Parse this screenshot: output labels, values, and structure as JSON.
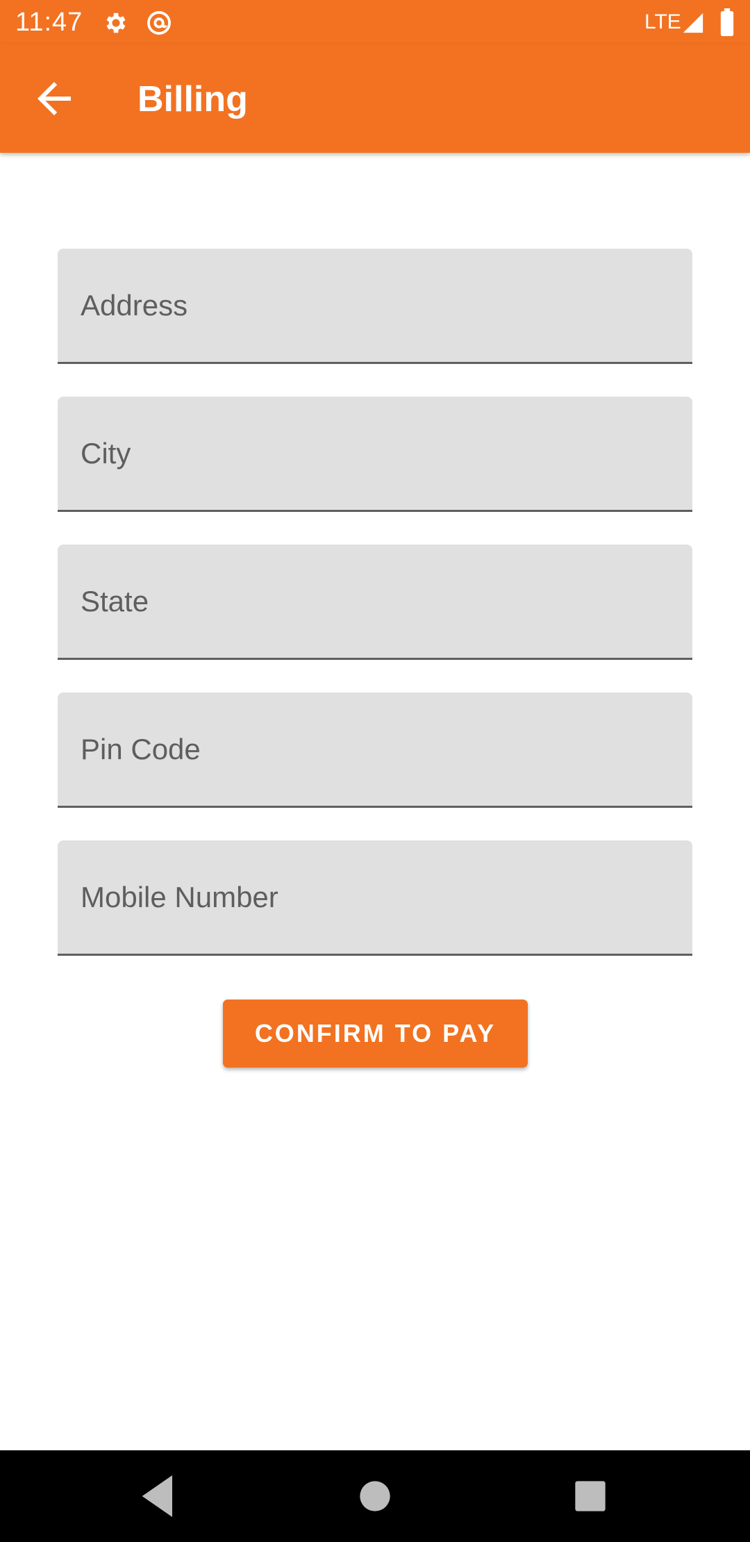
{
  "status_bar": {
    "time": "11:47",
    "network": "LTE",
    "icons": [
      "gear-icon",
      "at-sign-icon",
      "signal-icon",
      "battery-icon"
    ]
  },
  "app_bar": {
    "title": "Billing",
    "back_icon": "arrow-back-icon"
  },
  "form": {
    "fields": [
      {
        "name": "address",
        "placeholder": "Address",
        "value": ""
      },
      {
        "name": "city",
        "placeholder": "City",
        "value": ""
      },
      {
        "name": "state",
        "placeholder": "State",
        "value": ""
      },
      {
        "name": "pin_code",
        "placeholder": "Pin Code",
        "value": ""
      },
      {
        "name": "mobile_number",
        "placeholder": "Mobile Number",
        "value": ""
      }
    ],
    "confirm_label": "CONFIRM TO PAY"
  },
  "nav_bar": {
    "icons": [
      "back-triangle-icon",
      "home-circle-icon",
      "recents-square-icon"
    ]
  },
  "colors": {
    "accent": "#f27221",
    "field_background": "#e0e0e0",
    "field_underline": "#5f5f5f",
    "nav_background": "#000000"
  }
}
